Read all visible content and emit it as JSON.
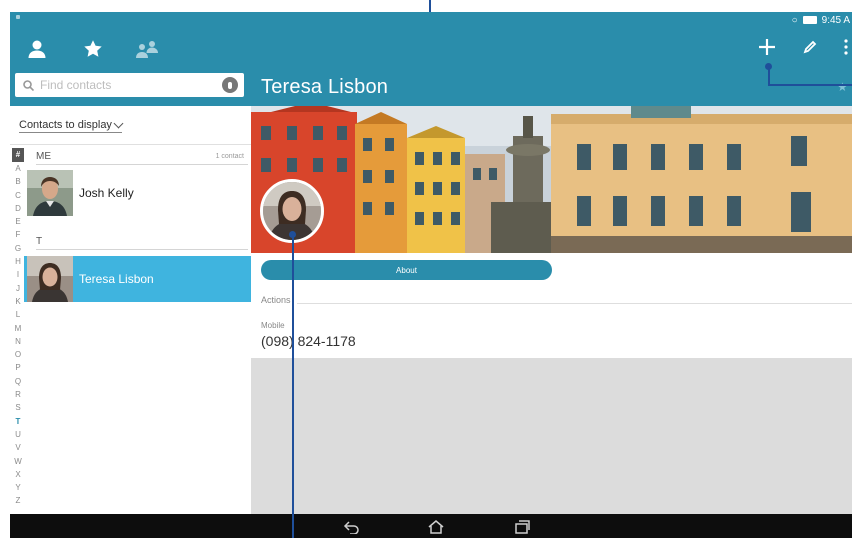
{
  "status_bar": {
    "time": "9:45 A"
  },
  "header": {
    "tabs": [
      {
        "name": "people",
        "icon": "person-icon"
      },
      {
        "name": "favorites",
        "icon": "star-icon"
      },
      {
        "name": "groups",
        "icon": "groups-icon"
      }
    ],
    "actions": [
      "add-icon",
      "edit-icon",
      "more-vert-icon"
    ]
  },
  "search": {
    "placeholder": "Find contacts"
  },
  "filter": {
    "label": "Contacts to display"
  },
  "alphabet": [
    "#",
    "A",
    "B",
    "C",
    "D",
    "E",
    "F",
    "G",
    "H",
    "I",
    "J",
    "K",
    "L",
    "M",
    "N",
    "O",
    "P",
    "Q",
    "R",
    "S",
    "T",
    "U",
    "V",
    "W",
    "X",
    "Y",
    "Z"
  ],
  "active_letter": "T",
  "sections": [
    {
      "letter": "ME",
      "count": "1 contact"
    },
    {
      "letter": "T",
      "count": ""
    }
  ],
  "contacts": [
    {
      "name": "Josh Kelly",
      "selected": false
    },
    {
      "name": "Teresa Lisbon",
      "selected": true
    }
  ],
  "detail": {
    "name": "Teresa Lisbon",
    "tab": "About",
    "actions_label": "Actions",
    "phone_type": "Mobile",
    "phone_number": "(098) 824-1178"
  },
  "nav": [
    "back-icon",
    "home-icon",
    "recent-apps-icon"
  ],
  "colors": {
    "header": "#2a8dab",
    "selected_row": "#3fb4df",
    "callout": "#1f4f9a",
    "nav_bar": "#0d0d0d"
  }
}
